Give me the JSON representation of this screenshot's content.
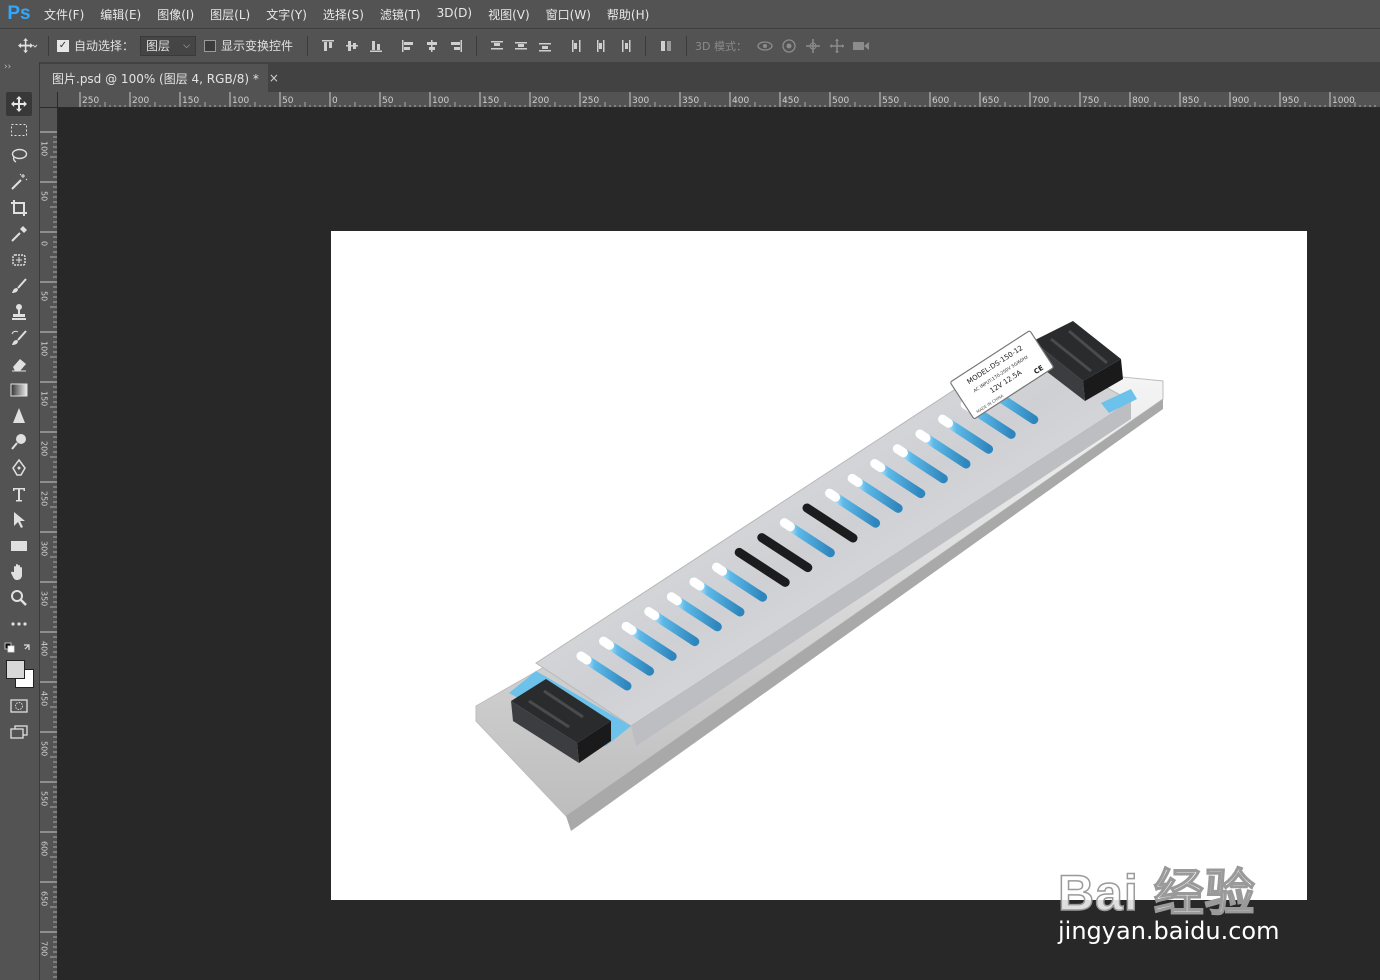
{
  "app": {
    "logo_text": "Ps",
    "accent": "#31a8ff"
  },
  "menu": [
    "文件(F)",
    "编辑(E)",
    "图像(I)",
    "图层(L)",
    "文字(Y)",
    "选择(S)",
    "滤镜(T)",
    "3D(D)",
    "视图(V)",
    "窗口(W)",
    "帮助(H)"
  ],
  "options": {
    "auto_select_label": "自动选择：",
    "auto_select_checked": true,
    "auto_select_target": "图层",
    "show_transform_label": "显示变换控件",
    "show_transform_checked": false,
    "mode_3d_label": "3D 模式："
  },
  "document": {
    "tab_title": "图片.psd @ 100% (图层 4, RGB/8) *",
    "close_glyph": "×"
  },
  "rulers": {
    "horizontal": [
      "250",
      "200",
      "150",
      "100",
      "50",
      "0",
      "50",
      "100",
      "150",
      "200",
      "250",
      "300",
      "350",
      "400",
      "450",
      "500",
      "550",
      "600",
      "650",
      "700",
      "750",
      "800",
      "850",
      "900",
      "950",
      "1000"
    ],
    "vertical": [
      "100",
      "50",
      "0",
      "50",
      "100",
      "150",
      "200",
      "250",
      "300",
      "350",
      "400",
      "450",
      "500",
      "550",
      "600",
      "650",
      "700"
    ]
  },
  "tools": [
    "move-tool-icon",
    "marquee-tool-icon",
    "lasso-tool-icon",
    "magic-wand-tool-icon",
    "crop-tool-icon",
    "eyedropper-tool-icon",
    "healing-brush-tool-icon",
    "brush-tool-icon",
    "stamp-tool-icon",
    "history-brush-tool-icon",
    "eraser-tool-icon",
    "gradient-tool-icon",
    "blur-tool-icon",
    "dodge-tool-icon",
    "pen-tool-icon",
    "type-tool-icon",
    "path-selection-tool-icon",
    "rectangle-tool-icon",
    "hand-tool-icon",
    "zoom-tool-icon",
    "more-tools-icon"
  ],
  "colors": {
    "foreground": "#d8d8d8",
    "background": "#ffffff"
  },
  "product_label": {
    "model": "MODEL:DS-150-12",
    "output": "12V 12.5A",
    "input": "AC INPUT:170-250V 50/60Hz",
    "mark": "CE",
    "origin": "MADE IN CHINA"
  },
  "watermark": {
    "logo": "Bai 经验",
    "url": "jingyan.baidu.com"
  }
}
